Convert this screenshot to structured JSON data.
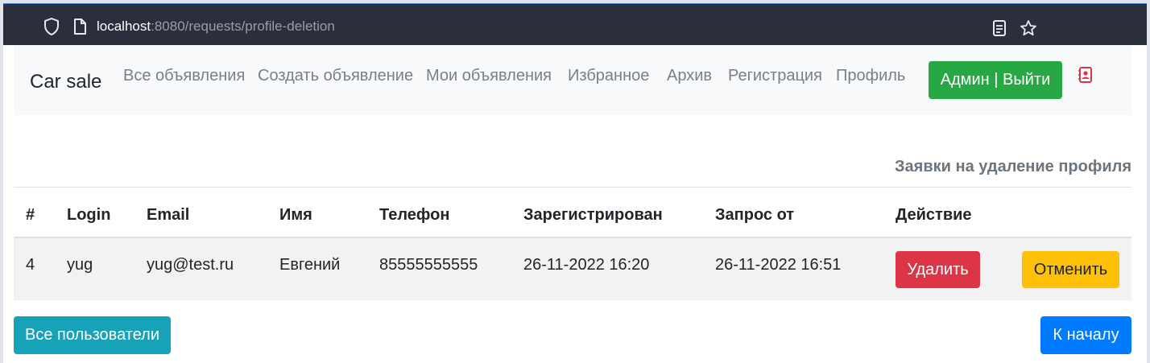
{
  "browser": {
    "url_host": "localhost",
    "url_path": ":8080/requests/profile-deletion"
  },
  "navbar": {
    "brand": "Car sale",
    "links": [
      "Все объявления",
      "Создать объявление",
      "Мои объявления",
      "Избранное",
      "Архив",
      "Регистрация",
      "Профиль"
    ],
    "admin_button": "Админ | Выйти"
  },
  "main": {
    "title": "Заявки на удаление профиля",
    "table": {
      "headers": [
        "#",
        "Login",
        "Email",
        "Имя",
        "Телефон",
        "Зарегистрирован",
        "Запрос от",
        "Действие"
      ],
      "rows": [
        {
          "num": "4",
          "login": "yug",
          "email": "yug@test.ru",
          "name": "Евгений",
          "phone": "85555555555",
          "registered": "26-11-2022 16:20",
          "requested": "26-11-2022 16:51",
          "delete_label": "Удалить",
          "cancel_label": "Отменить"
        }
      ]
    },
    "all_users_button": "Все пользователи",
    "home_button": "К началу"
  },
  "colors": {
    "success": "#28a745",
    "danger": "#dc3545",
    "warning": "#ffc107",
    "info": "#17a2b8",
    "primary": "#007bff"
  }
}
